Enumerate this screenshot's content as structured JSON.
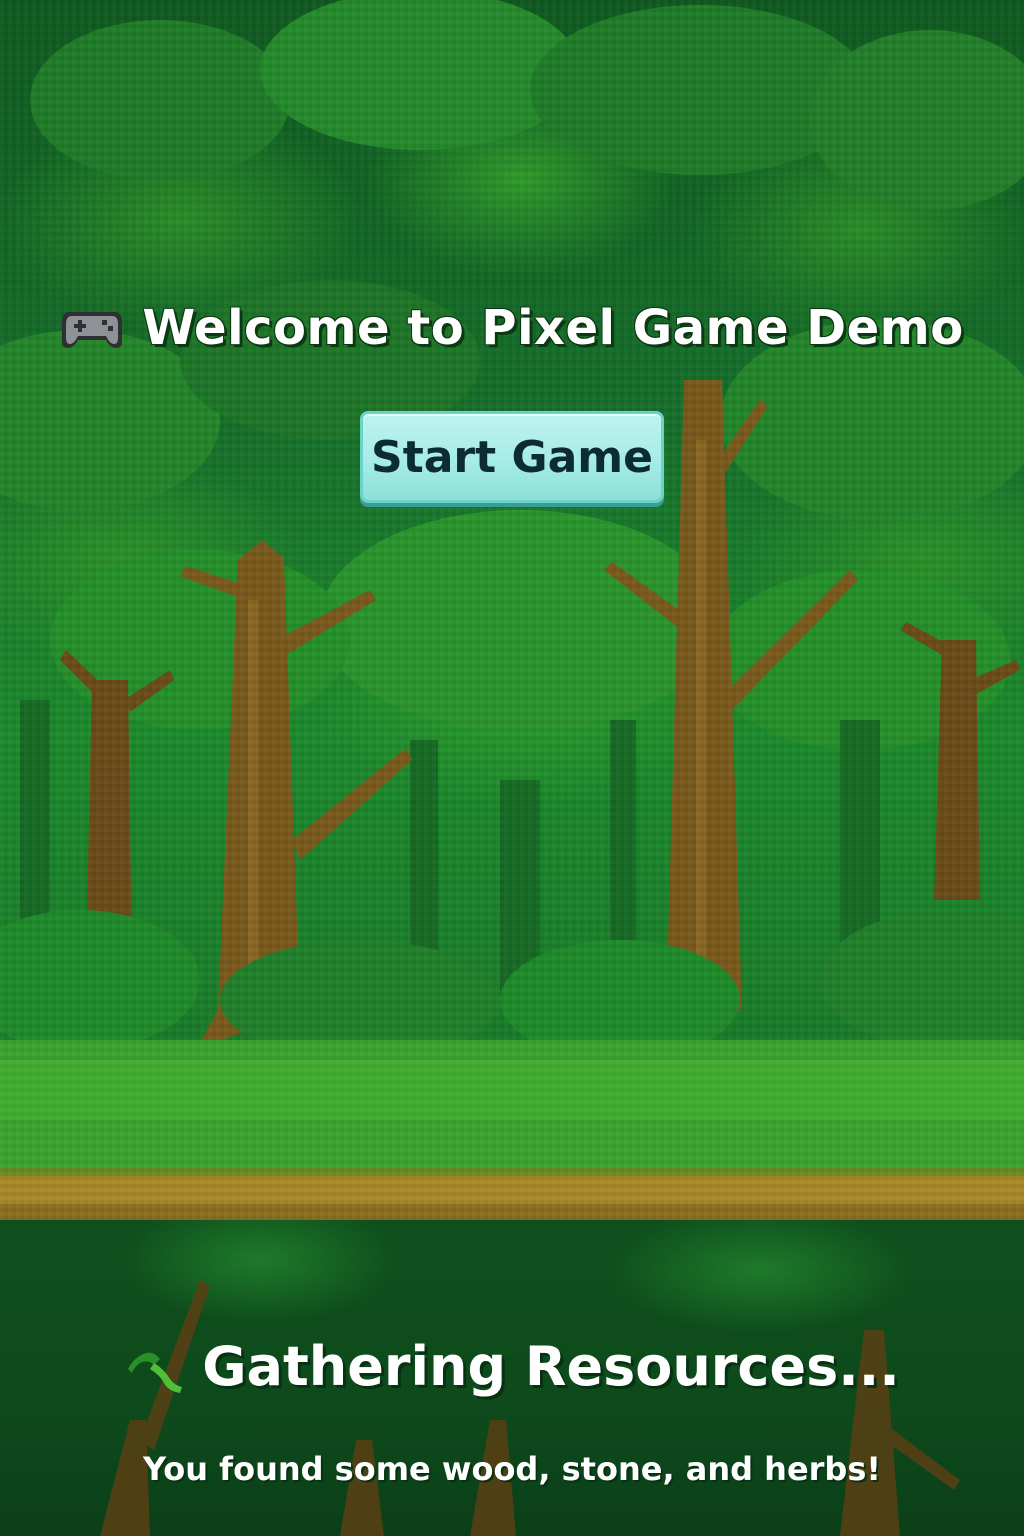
{
  "title": {
    "text": "Welcome to Pixel Game Demo",
    "icon": "gamepad-icon"
  },
  "start_button": {
    "label": "Start Game"
  },
  "status": {
    "icon": "sprout-icon",
    "heading": "Gathering Resources...",
    "message": "You found some wood, stone, and herbs!"
  },
  "colors": {
    "forest_dark": "#0f5a20",
    "forest_light": "#2f9e2c",
    "trunk": "#7a5a1c",
    "dirt_path": "#a98a2a",
    "button_fill": "#a6ece7",
    "button_text": "#0c2b33",
    "text": "#ffffff"
  }
}
